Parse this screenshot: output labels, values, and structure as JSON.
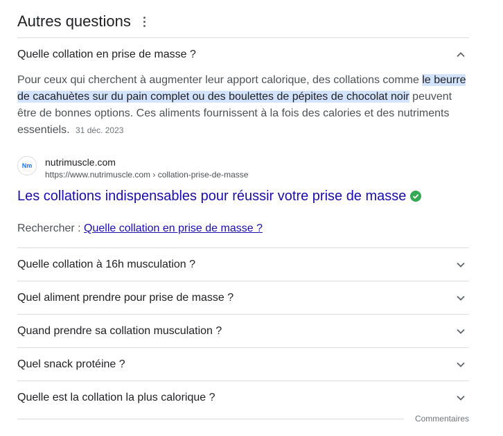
{
  "header": {
    "title": "Autres questions",
    "menu_icon": "kebab-menu-icon"
  },
  "expanded": {
    "question": "Quelle collation en prise de masse ?",
    "answer_before": "Pour ceux qui cherchent à augmenter leur apport calorique, des collations comme ",
    "answer_highlight": "le beurre de cacahuètes sur du pain complet ou des boulettes de pépites de chocolat noir",
    "answer_after": " peuvent être de bonnes options. Ces aliments fournissent à la fois des calories et des nutriments essentiels.",
    "date": "31 déc. 2023",
    "source": {
      "favicon_text": "Nm",
      "site_name": "nutrimuscle.com",
      "url": "https://www.nutrimuscle.com › collation-prise-de-masse",
      "title": "Les collations indispensables pour réussir votre prise de masse",
      "verified_icon": "verified-check-icon"
    },
    "search_prefix": "Rechercher : ",
    "search_link": "Quelle collation en prise de masse ?"
  },
  "questions": [
    "Quelle collation à 16h musculation ?",
    "Quel aliment prendre pour prise de masse ?",
    "Quand prendre sa collation musculation ?",
    "Quel snack protéine ?",
    "Quelle est la collation la plus calorique ?"
  ],
  "footer": {
    "feedback": "Commentaires"
  },
  "colors": {
    "link": "#1a0dab",
    "highlight": "#d3e3fd",
    "verified": "#34a853"
  }
}
